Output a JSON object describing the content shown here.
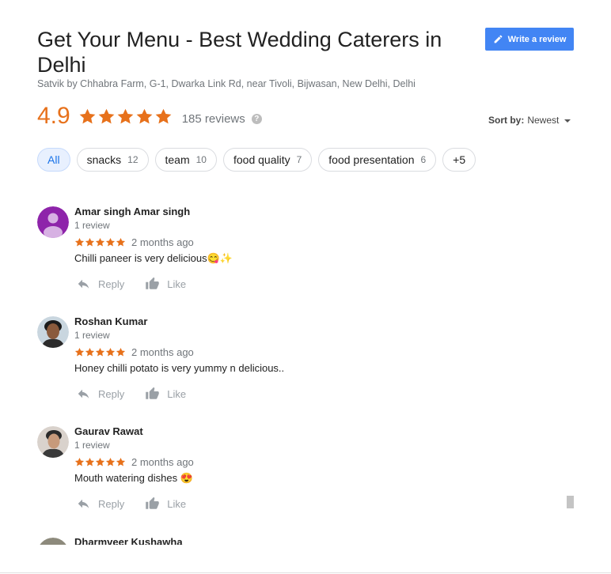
{
  "header": {
    "title": "Get Your Menu - Best Wedding Caterers in Delhi",
    "address": "Satvik by Chhabra Farm, G-1, Dwarka Link Rd, near Tivoli, Bijwasan, New Delhi, Delhi",
    "write_review_label": "Write a review"
  },
  "rating": {
    "value": "4.9",
    "stars": 5,
    "count_label": "185 reviews",
    "help_icon": "?"
  },
  "sort": {
    "label": "Sort by:",
    "value": "Newest"
  },
  "chips": [
    {
      "label": "All",
      "count": ""
    },
    {
      "label": "snacks",
      "count": "12"
    },
    {
      "label": "team",
      "count": "10"
    },
    {
      "label": "food quality",
      "count": "7"
    },
    {
      "label": "food presentation",
      "count": "6"
    },
    {
      "label": "+5",
      "count": ""
    }
  ],
  "reviews": [
    {
      "name": "Amar singh Amar singh",
      "sub": "1 review",
      "stars": 5,
      "time": "2 months ago",
      "text": "Chilli paneer is very delicious😋✨",
      "avatar": "default-person-purple",
      "reply_label": "Reply",
      "like_label": "Like"
    },
    {
      "name": "Roshan Kumar",
      "sub": "1 review",
      "stars": 5,
      "time": "2 months ago",
      "text": "Honey chilli potato is very yummy n delicious..",
      "avatar": "photo-person",
      "reply_label": "Reply",
      "like_label": "Like"
    },
    {
      "name": "Gaurav Rawat",
      "sub": "1 review",
      "stars": 5,
      "time": "2 months ago",
      "text": "Mouth watering dishes 😍",
      "avatar": "photo-person",
      "reply_label": "Reply",
      "like_label": "Like"
    },
    {
      "name": "Dharmveer Kushawha",
      "avatar": "photo-person"
    }
  ],
  "colors": {
    "star": "#e7711b",
    "accent": "#4285f4",
    "chip_active_bg": "#e8f0fe",
    "muted": "#70757a",
    "action_gray": "#9aa0a6"
  }
}
